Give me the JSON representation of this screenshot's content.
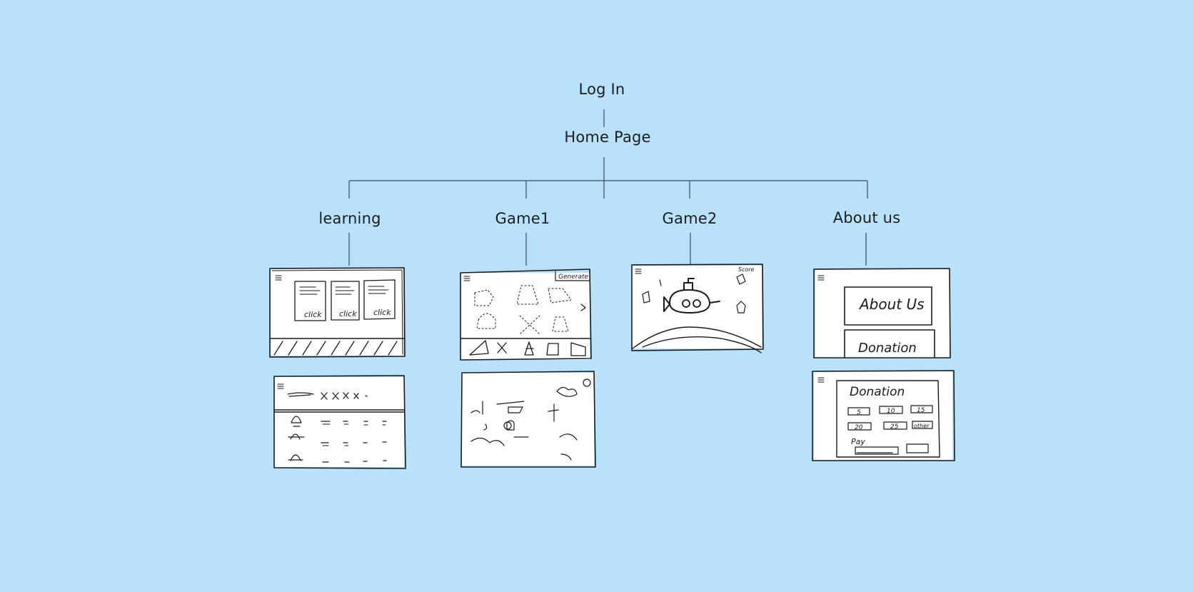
{
  "background": "#b8e2fc",
  "root": {
    "label": "Log In"
  },
  "home": {
    "label": "Home Page"
  },
  "sections": [
    {
      "id": "learning",
      "label": "learning"
    },
    {
      "id": "game1",
      "label": "Game1"
    },
    {
      "id": "game2",
      "label": "Game2"
    },
    {
      "id": "about",
      "label": "About us"
    }
  ],
  "sketch_text": {
    "learning_click": "click",
    "game1_button": "Generate",
    "game2_score": "Score",
    "about_button1": "About Us",
    "about_button2": "Donation",
    "donation_title": "Donation",
    "donation_pay": "Pay",
    "donation_amounts": [
      "5",
      "10",
      "15",
      "20",
      "25",
      "other"
    ]
  }
}
